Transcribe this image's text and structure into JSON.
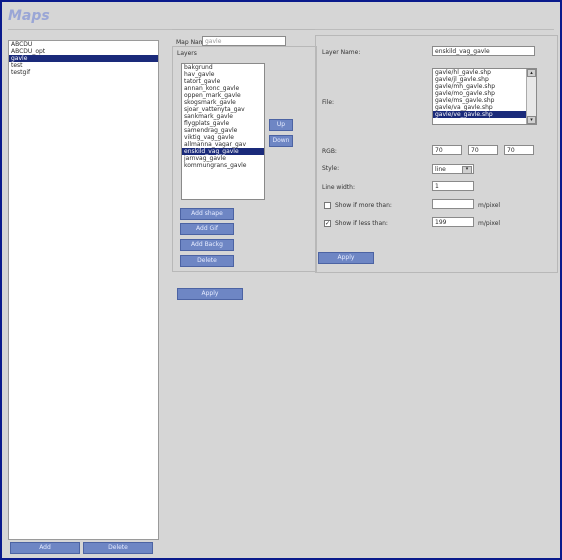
{
  "app": {
    "title": "Maps"
  },
  "maps": {
    "items": [
      "ABCDU",
      "ABCDU_opt",
      "gavle",
      "test",
      "testgif"
    ],
    "selected_index": 2,
    "add_label": "Add",
    "delete_label": "Delete"
  },
  "map_name": {
    "label": "Map Name",
    "value": "gavle"
  },
  "layers": {
    "heading": "Layers",
    "items": [
      "bakgrund",
      "hav_gavle",
      "tatort_gavle",
      "annan_konc_gavle",
      "oppen_mark_gavle",
      "skogsmark_gavle",
      "sjoar_vattenyta_gav",
      "sankmark_gavle",
      "flygplats_gavle",
      "samendrag_gavle",
      "viktig_vag_gavle",
      "allmanna_vagar_gav",
      "enskild_vag_gavle",
      "jarnvag_gavle",
      "kommungrans_gavle"
    ],
    "selected_index": 12,
    "up_label": "Up",
    "down_label": "Down",
    "add_shape_label": "Add shape",
    "add_gif_label": "Add Gif",
    "add_backg_label": "Add Backg",
    "delete_label": "Delete"
  },
  "main_apply_label": "Apply",
  "layer_props": {
    "layer_name_label": "Layer Name:",
    "layer_name_value": "enskild_vag_gavle",
    "file_label": "File:",
    "files": [
      "gavle/hl_gavle.shp",
      "gavle/jl_gavle.shp",
      "gavle/mh_gavle.shp",
      "gavle/mo_gavle.shp",
      "gavle/ms_gavle.shp",
      "gavle/va_gavle.shp",
      "gavle/ve_gavle.shp"
    ],
    "file_selected_index": 6,
    "rgb_label": "RGB:",
    "rgb": [
      "70",
      "70",
      "70"
    ],
    "style_label": "Style:",
    "style_value": "line",
    "line_width_label": "Line width:",
    "line_width_value": "1",
    "show_more_label": "Show if more than:",
    "show_more_checked": false,
    "show_more_value": "",
    "show_less_label": "Show if less than:",
    "show_less_checked": true,
    "show_less_value": "199",
    "unit": "m/pixel",
    "apply_label": "Apply"
  }
}
